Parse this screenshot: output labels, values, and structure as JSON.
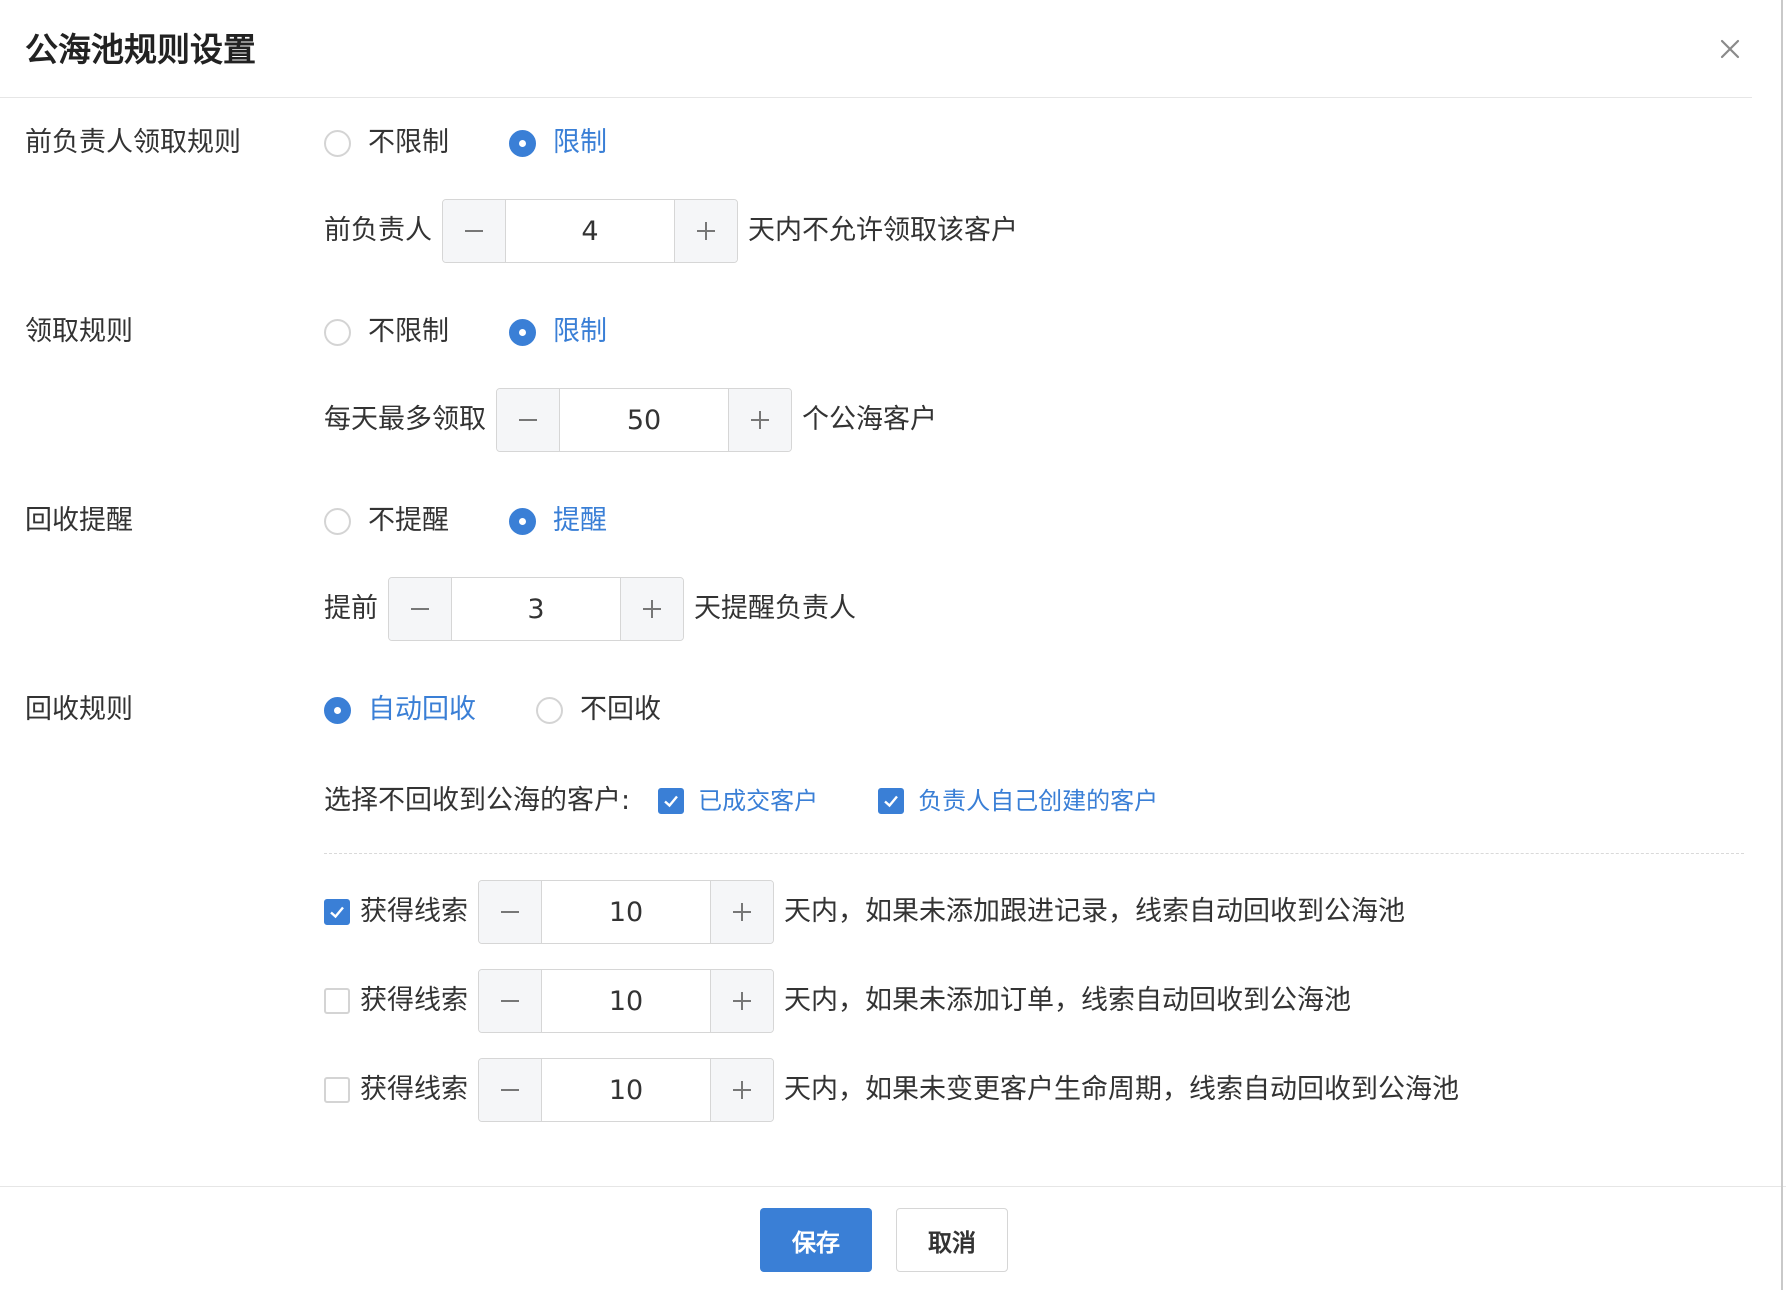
{
  "dialog": {
    "title": "公海池规则设置",
    "close_icon": "close-icon"
  },
  "colors": {
    "accent": "#3a7fd6",
    "border": "#d6d6d6",
    "text": "#333333",
    "stepper_button_bg": "#f5f6f8"
  },
  "former_owner_rule": {
    "label": "前负责人领取规则",
    "options": [
      "不限制",
      "限制"
    ],
    "selected": "限制",
    "prefix": "前负责人",
    "value": "4",
    "suffix": "天内不允许领取该客户"
  },
  "claim_rule": {
    "label": "领取规则",
    "options": [
      "不限制",
      "限制"
    ],
    "selected": "限制",
    "prefix": "每天最多领取",
    "value": "50",
    "suffix": "个公海客户"
  },
  "reclaim_reminder": {
    "label": "回收提醒",
    "options": [
      "不提醒",
      "提醒"
    ],
    "selected": "提醒",
    "prefix": "提前",
    "value": "3",
    "suffix": "天提醒负责人"
  },
  "reclaim_rule": {
    "label": "回收规则",
    "options": [
      "自动回收",
      "不回收"
    ],
    "selected": "自动回收",
    "exclude_label": "选择不回收到公海的客户:",
    "exclude_options": [
      {
        "label": "已成交客户",
        "checked": true
      },
      {
        "label": "负责人自己创建的客户",
        "checked": true
      }
    ],
    "conditions": [
      {
        "checked": true,
        "prefix": "获得线索",
        "value": "10",
        "suffix": "天内，如果未添加跟进记录，线索自动回收到公海池"
      },
      {
        "checked": false,
        "prefix": "获得线索",
        "value": "10",
        "suffix": "天内，如果未添加订单，线索自动回收到公海池"
      },
      {
        "checked": false,
        "prefix": "获得线索",
        "value": "10",
        "suffix": "天内，如果未变更客户生命周期，线索自动回收到公海池"
      }
    ]
  },
  "footer": {
    "save_label": "保存",
    "cancel_label": "取消"
  }
}
